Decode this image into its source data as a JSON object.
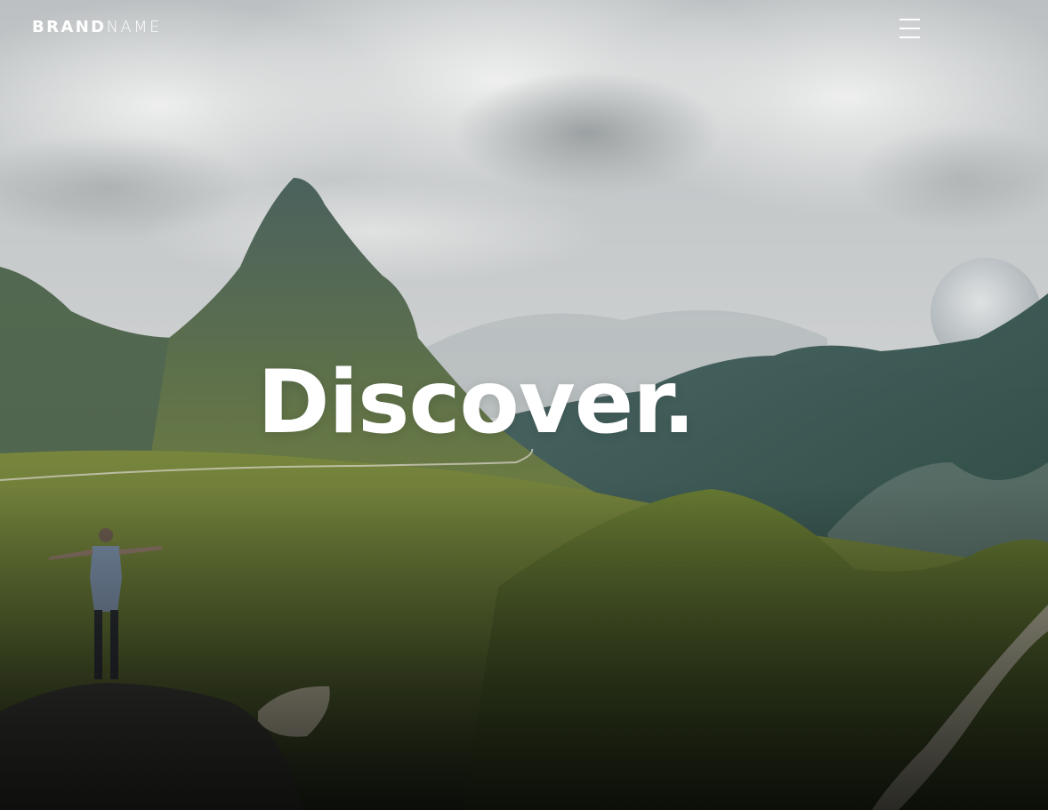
{
  "header": {
    "brand_bold": "BRAND",
    "brand_light": "NAME",
    "menu_icon": "hamburger-menu-icon"
  },
  "hero": {
    "headline": "Discover."
  },
  "colors": {
    "text": "#ffffff",
    "sky": "#c9cdd0",
    "valley": "#6f7f3b",
    "mountain_shadow": "#3f5a57"
  }
}
